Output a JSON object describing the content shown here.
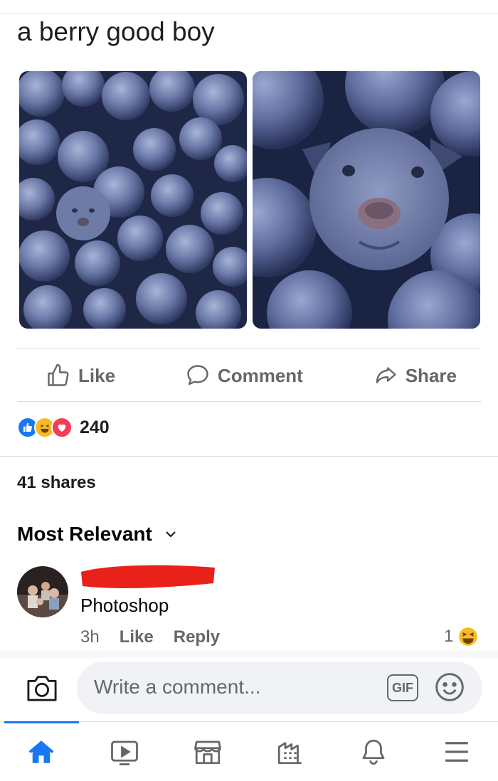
{
  "post": {
    "text": "a berry good boy"
  },
  "actions": {
    "like": "Like",
    "comment": "Comment",
    "share": "Share"
  },
  "reactions": {
    "count": "240",
    "icons": [
      "like-icon",
      "haha-icon",
      "love-icon"
    ]
  },
  "shares": "41 shares",
  "comments_sort": "Most Relevant",
  "comment": {
    "text": "Photoshop",
    "time": "3h",
    "like": "Like",
    "reply": "Reply",
    "reaction_count": "1"
  },
  "composer": {
    "placeholder": "Write a comment...",
    "gif": "GIF"
  },
  "nav": [
    "home-icon",
    "watch-icon",
    "marketplace-icon",
    "pages-icon",
    "notifications-icon",
    "menu-icon"
  ],
  "colors": {
    "accent": "#1877f2",
    "muted": "#65676b",
    "blueberry": "#5a6a9c",
    "redaction": "#e8221b"
  }
}
